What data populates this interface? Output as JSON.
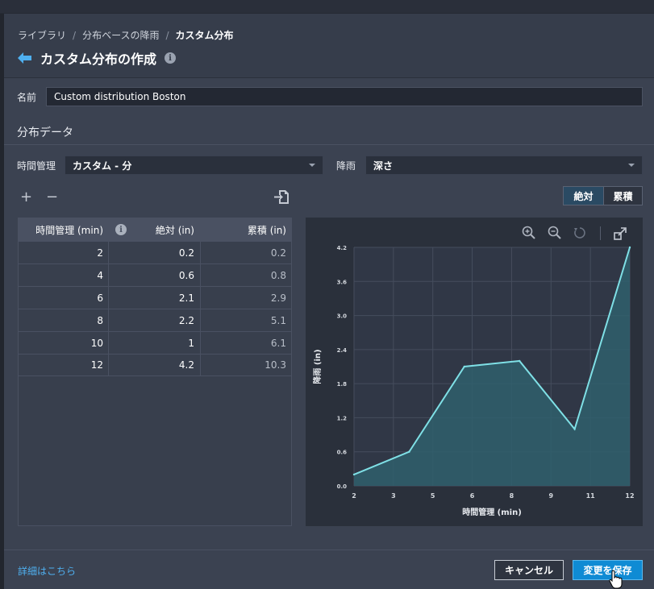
{
  "breadcrumb": {
    "items": [
      "ライブラリ",
      "分布ベースの降雨",
      "カスタム分布"
    ],
    "separator": "/"
  },
  "page": {
    "title": "カスタム分布の作成",
    "info": "i"
  },
  "form": {
    "name_label": "名前",
    "name_value": "Custom distribution Boston",
    "section_title": "分布データ",
    "time_label": "時間管理",
    "time_value": "カスタム - 分",
    "rain_label": "降雨",
    "rain_value": "深さ"
  },
  "toolbar": {
    "add": "+",
    "remove": "−",
    "toggle_absolute": "絶対",
    "toggle_cumulative": "累積"
  },
  "table": {
    "headers": [
      "時間管理 (min)",
      "絶対 (in)",
      "累積 (in)"
    ],
    "info": "i",
    "rows": [
      [
        "2",
        "0.2",
        "0.2"
      ],
      [
        "4",
        "0.6",
        "0.8"
      ],
      [
        "6",
        "2.1",
        "2.9"
      ],
      [
        "8",
        "2.2",
        "5.1"
      ],
      [
        "10",
        "1",
        "6.1"
      ],
      [
        "12",
        "4.2",
        "10.3"
      ]
    ]
  },
  "chart_data": {
    "type": "area",
    "title": "",
    "xlabel": "時間管理 (min)",
    "ylabel": "降雨 (in)",
    "x_ticks": [
      "2",
      "3",
      "5",
      "6",
      "8",
      "9",
      "11",
      "12"
    ],
    "y_ticks": [
      "0.0",
      "0.6",
      "1.2",
      "1.8",
      "2.4",
      "3.0",
      "3.6",
      "4.2"
    ],
    "x": [
      2,
      4,
      6,
      8,
      10,
      12
    ],
    "values": [
      0.2,
      0.6,
      2.1,
      2.2,
      1,
      4.2
    ],
    "xlim": [
      2,
      12
    ],
    "ylim": [
      0,
      4.2
    ],
    "grid": true,
    "colors": {
      "line": "#7fe0e6",
      "fill": "#2f5f6c"
    }
  },
  "footer": {
    "link": "詳細はこちら",
    "cancel": "キャンセル",
    "save": "変更を保存"
  },
  "colors": {
    "accent": "#0f8bd4",
    "link": "#4fb0f0",
    "back_arrow": "#4fb0f0"
  }
}
